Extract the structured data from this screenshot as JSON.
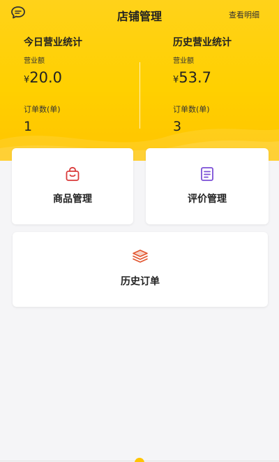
{
  "header": {
    "title": "店铺管理",
    "detail_link": "查看明细",
    "message_icon": "chat-bubble-icon"
  },
  "today": {
    "title": "今日营业统计",
    "revenue_label": "营业额",
    "currency": "¥",
    "revenue": "20.0",
    "orders_label": "订单数(单)",
    "orders": "1"
  },
  "history": {
    "title": "历史营业统计",
    "revenue_label": "营业额",
    "currency": "¥",
    "revenue": "53.7",
    "orders_label": "订单数(单)",
    "orders": "3"
  },
  "menu": {
    "goods": {
      "label": "商品管理",
      "icon": "shopping-bag-icon"
    },
    "reviews": {
      "label": "评价管理",
      "icon": "clipboard-list-icon"
    },
    "history_orders": {
      "label": "历史订单",
      "icon": "layers-stack-icon"
    }
  },
  "colors": {
    "banner": "#ffd000",
    "goods_icon": "#d93a3a",
    "reviews_icon": "#7b4fd6",
    "history_icon": "#e2552f"
  }
}
